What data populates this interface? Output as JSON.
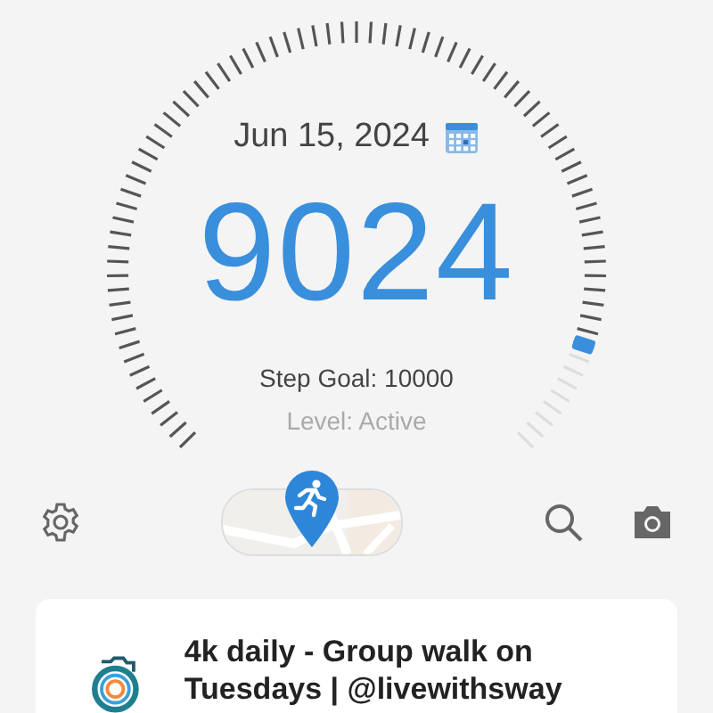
{
  "date": "Jun 15, 2024",
  "steps": "9024",
  "step_goal": "Step Goal: 10000",
  "activity_level": "Level: Active",
  "card": {
    "title": "4k daily - Group walk on Tuesdays | @livewithsway"
  }
}
